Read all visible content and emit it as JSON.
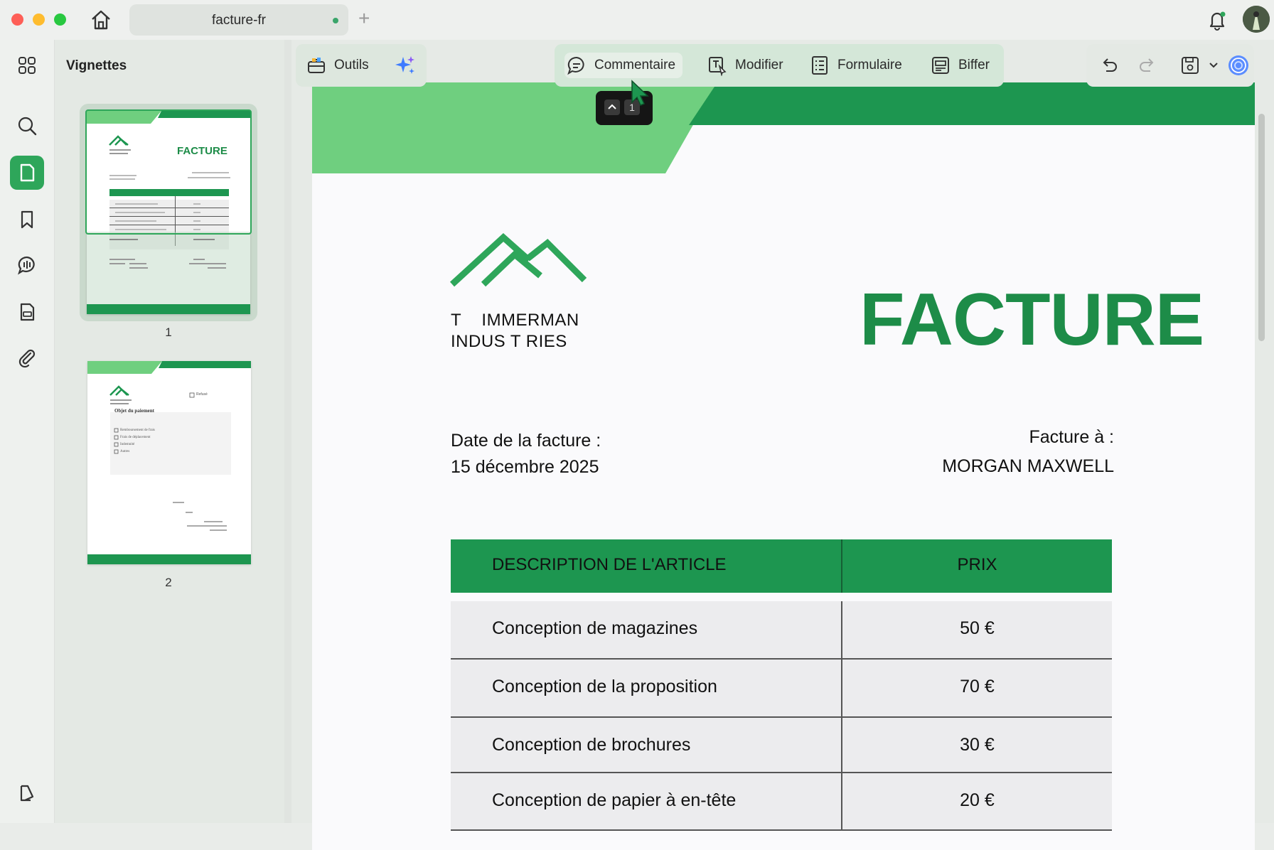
{
  "window": {
    "tab_title": "facture-fr",
    "tab_add": "+"
  },
  "sidebar": {
    "panel_title": "Vignettes",
    "pages": [
      "1",
      "2"
    ],
    "thumb1": {
      "title": "FACTURE",
      "col_header": "DESCRIPTION DE L'ARTICLE",
      "col_price": "PRIX"
    },
    "thumb2": {
      "section_title": "Objet du paiement",
      "options": [
        "Remboursement de frais",
        "Frais de déplacement",
        "Indemnité",
        "Autres"
      ],
      "checkbox_label": "Refusé"
    }
  },
  "toolbar": {
    "tools_label": "Outils",
    "comment_label": "Commentaire",
    "edit_label": "Modifier",
    "form_label": "Formulaire",
    "redact_label": "Biffer"
  },
  "popup": {
    "page_number": "1"
  },
  "invoice": {
    "company_line1": "T    IMMERMAN",
    "company_line2": "INDUS T RIES",
    "title": "FACTURE",
    "date_label": "Date de la facture :",
    "date_value": "15 décembre 2025",
    "bill_to_label": "Facture à :",
    "bill_to_value": "MORGAN MAXWELL",
    "table": {
      "header_desc": "DESCRIPTION DE L'ARTICLE",
      "header_price": "PRIX",
      "rows": [
        {
          "desc": "Conception de magazines",
          "price": "50 €"
        },
        {
          "desc": "Conception de la proposition",
          "price": "70 €"
        },
        {
          "desc": "Conception de brochures",
          "price": "30 €"
        },
        {
          "desc": "Conception de papier à en-tête",
          "price": "20 €"
        }
      ]
    }
  },
  "colors": {
    "brand_green": "#1d8c48",
    "header_green": "#1d9650",
    "light_green": "#6fcf7f",
    "rail_active": "#2ea65a"
  }
}
